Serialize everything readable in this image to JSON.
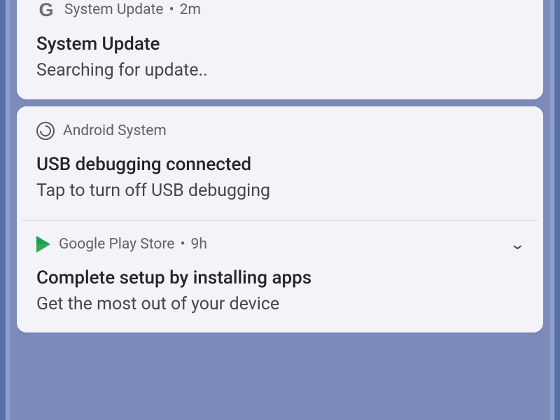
{
  "notifications": [
    {
      "app": "System Update",
      "time": "2m",
      "title": "System Update",
      "body": "Searching for update.."
    },
    {
      "app": "Android System",
      "title": "USB debugging connected",
      "body": "Tap to turn off USB debugging"
    },
    {
      "app": "Google Play Store",
      "time": "9h",
      "title": "Complete setup by installing apps",
      "body": "Get the most out of your device"
    }
  ],
  "sep": "•"
}
